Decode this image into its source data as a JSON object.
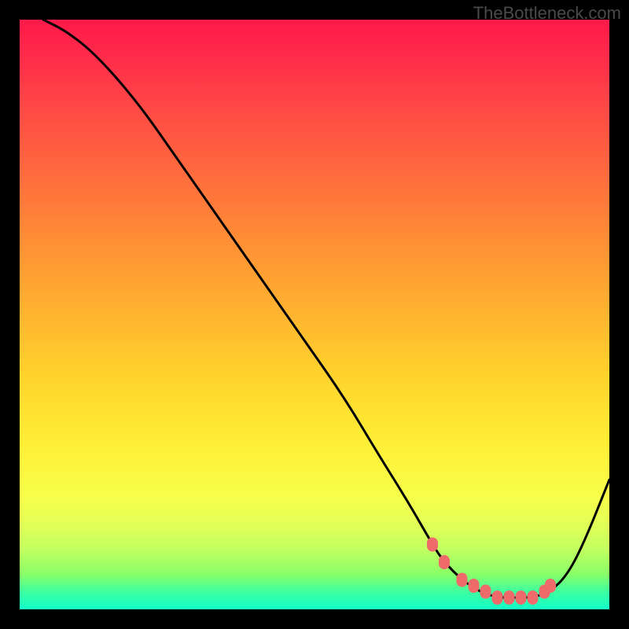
{
  "watermark": "TheBottleneck.com",
  "chart_data": {
    "type": "line",
    "title": "",
    "xlabel": "",
    "ylabel": "",
    "xlim": [
      0,
      100
    ],
    "ylim": [
      0,
      100
    ],
    "series": [
      {
        "name": "bottleneck-curve",
        "x": [
          4,
          8,
          13,
          20,
          27,
          34,
          41,
          48,
          55,
          61,
          66,
          70,
          72,
          75,
          78,
          81,
          84,
          87,
          90,
          93,
          96,
          100
        ],
        "y": [
          100,
          98,
          94,
          86,
          76,
          66,
          56,
          46,
          36,
          26,
          18,
          11,
          8,
          5,
          3,
          2,
          2,
          2,
          3,
          6,
          12,
          22
        ]
      }
    ],
    "markers": {
      "name": "highlight-dots",
      "x": [
        70,
        72,
        75,
        77,
        79,
        81,
        83,
        85,
        87,
        89,
        90
      ],
      "y": [
        11,
        8,
        5,
        4,
        3,
        2,
        2,
        2,
        2,
        3,
        4
      ]
    }
  }
}
